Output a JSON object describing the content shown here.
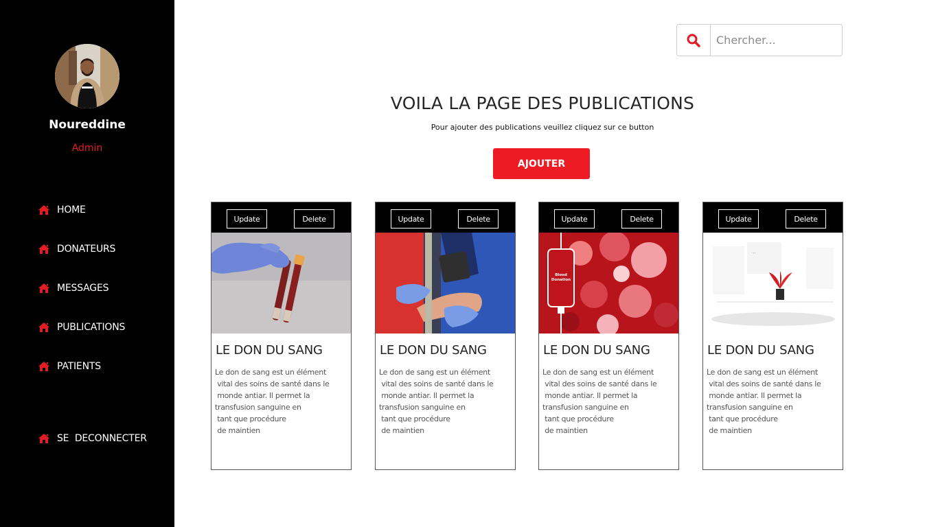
{
  "sidebar": {
    "user_name": "Noureddine",
    "user_role": "Admin",
    "items": [
      {
        "label": "HOME",
        "icon": "home-icon"
      },
      {
        "label": "DONATEURS",
        "icon": "home-icon"
      },
      {
        "label": "MESSAGES",
        "icon": "home-icon"
      },
      {
        "label": "PUBLICATIONS",
        "icon": "home-icon"
      },
      {
        "label": "PATIENTS",
        "icon": "home-icon"
      }
    ],
    "logout": {
      "label": "SE  DECONNECTER",
      "icon": "home-icon"
    }
  },
  "search": {
    "placeholder": "Chercher...",
    "value": "",
    "icon": "search-icon"
  },
  "header": {
    "title": "VOILA LA PAGE DES PUBLICATIONS",
    "subtitle": "Pour ajouter des publications veuillez cliquez sur ce button",
    "add_label": "AJOUTER"
  },
  "cards": [
    {
      "update": "Update",
      "delete": "Delete",
      "title": "LE DON DU SANG",
      "text": "Le don de sang est un élément\n vital des soins de santé dans le\n monde antiar. Il permet la\ntransfusion sanguine en\n tant que procédure\n de maintien"
    },
    {
      "update": "Update",
      "delete": "Delete",
      "title": "LE DON DU SANG",
      "text": "Le don de sang est un élément\n vital des soins de santé dans le\n monde antiar. Il permet la\ntransfusion sanguine en\n tant que procédure\n de maintien"
    },
    {
      "update": "Update",
      "delete": "Delete",
      "title": "LE DON DU SANG",
      "text": "Le don de sang est un élément\n vital des soins de santé dans le\n monde antiar. Il permet la\ntransfusion sanguine en\n tant que procédure\n de maintien",
      "image_text": [
        "Blood",
        "Donation"
      ]
    },
    {
      "update": "Update",
      "delete": "Delete",
      "title": "LE DON DU SANG",
      "text": "Le don de sang est un élément\n vital des soins de santé dans le\n monde antiar. Il permet la\ntransfusion sanguine en\n tant que procédure\n de maintien"
    }
  ],
  "colors": {
    "sidebar_bg": "#000000",
    "accent": "#ed1c24",
    "card_toolbar_bg": "#000000"
  }
}
